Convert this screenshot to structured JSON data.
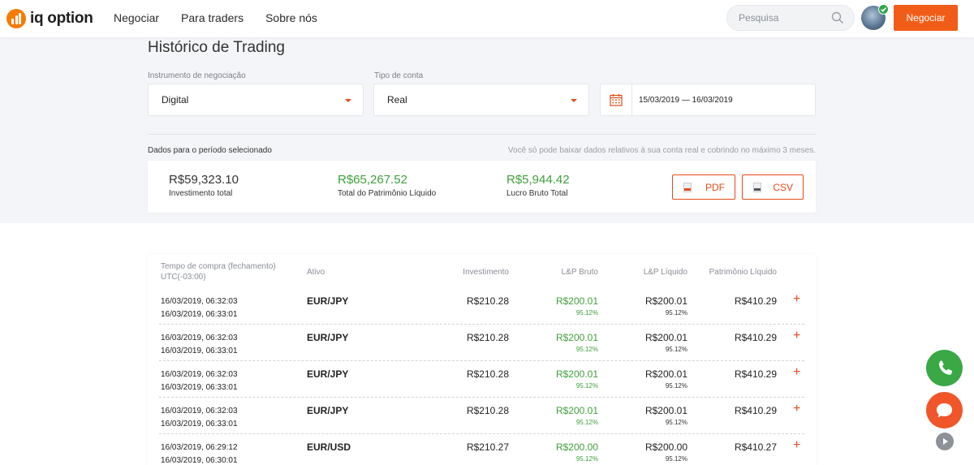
{
  "header": {
    "logo_text": "iq option",
    "nav": [
      "Negociar",
      "Para traders",
      "Sobre nós"
    ],
    "search_placeholder": "Pesquisa",
    "trade_button": "Negociar"
  },
  "page": {
    "title": "Histórico de Trading",
    "instrument_label": "Instrumento de negociação",
    "instrument_value": "Digital",
    "account_label": "Tipo de conta",
    "account_value": "Real",
    "date_range": "15/03/2019 — 16/03/2019",
    "period_label": "Dados para o período selecionado",
    "period_note": "Você só pode baixar dados relativos à sua conta real e cobrindo no máximo 3 meses."
  },
  "summary": {
    "investment": {
      "value": "R$59,323.10",
      "label": "Investimento total"
    },
    "equity": {
      "value": "R$65,267.52",
      "label": "Total do Patrimônio Líquido"
    },
    "gross": {
      "value": "R$5,944.42",
      "label": "Lucro Bruto Total"
    },
    "pdf_button": "PDF",
    "csv_button": "CSV"
  },
  "table": {
    "headers": {
      "time_line1": "Tempo de compra (fechamento)",
      "time_line2": "UTC(-03:00)",
      "asset": "Ativo",
      "investment": "Investimento",
      "gross": "L&P Bruto",
      "net": "L&P Líquido",
      "equity": "Patrimônio Líquido"
    },
    "rows": [
      {
        "open": "16/03/2019, 06:32:03",
        "close": "16/03/2019, 06:33:01",
        "asset": "EUR/JPY",
        "investment": "R$210.28",
        "gross": "R$200.01",
        "gross_pct": "95.12%",
        "net": "R$200.01",
        "net_pct": "95.12%",
        "equity": "R$410.29"
      },
      {
        "open": "16/03/2019, 06:32:03",
        "close": "16/03/2019, 06:33:01",
        "asset": "EUR/JPY",
        "investment": "R$210.28",
        "gross": "R$200.01",
        "gross_pct": "95.12%",
        "net": "R$200.01",
        "net_pct": "95.12%",
        "equity": "R$410.29"
      },
      {
        "open": "16/03/2019, 06:32:03",
        "close": "16/03/2019, 06:33:01",
        "asset": "EUR/JPY",
        "investment": "R$210.28",
        "gross": "R$200.01",
        "gross_pct": "95.12%",
        "net": "R$200.01",
        "net_pct": "95.12%",
        "equity": "R$410.29"
      },
      {
        "open": "16/03/2019, 06:32:03",
        "close": "16/03/2019, 06:33:01",
        "asset": "EUR/JPY",
        "investment": "R$210.28",
        "gross": "R$200.01",
        "gross_pct": "95.12%",
        "net": "R$200.01",
        "net_pct": "95.12%",
        "equity": "R$410.29"
      },
      {
        "open": "16/03/2019, 06:29:12",
        "close": "16/03/2019, 06:30:01",
        "asset": "EUR/USD",
        "investment": "R$210.27",
        "gross": "R$200.00",
        "gross_pct": "95.12%",
        "net": "R$200.00",
        "net_pct": "95.12%",
        "equity": "R$410.27"
      }
    ],
    "expand_symbol": "+"
  },
  "colors": {
    "accent": "#f25c19",
    "positive": "#3ea03a",
    "phone": "#3aa845",
    "chat": "#f0562a"
  },
  "icons": [
    "search-icon",
    "calendar-icon",
    "pdf-file-icon",
    "csv-file-icon",
    "phone-icon",
    "chat-icon",
    "play-icon",
    "verified-check-icon"
  ]
}
